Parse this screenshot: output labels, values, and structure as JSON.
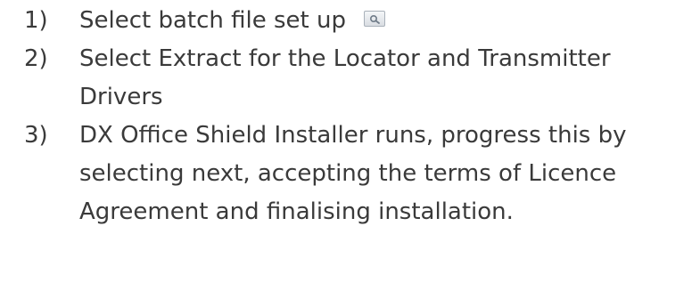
{
  "steps": [
    {
      "number": "1)",
      "lines": [
        "Select batch file set up"
      ],
      "icon": "batch-setup-button-icon"
    },
    {
      "number": "2)",
      "lines": [
        "Select Extract for the Locator and Transmitter",
        "Drivers"
      ]
    },
    {
      "number": "3)",
      "lines": [
        "DX Office Shield Installer runs, progress this by",
        "selecting next, accepting the terms of Licence",
        "Agreement and finalising installation."
      ]
    }
  ]
}
